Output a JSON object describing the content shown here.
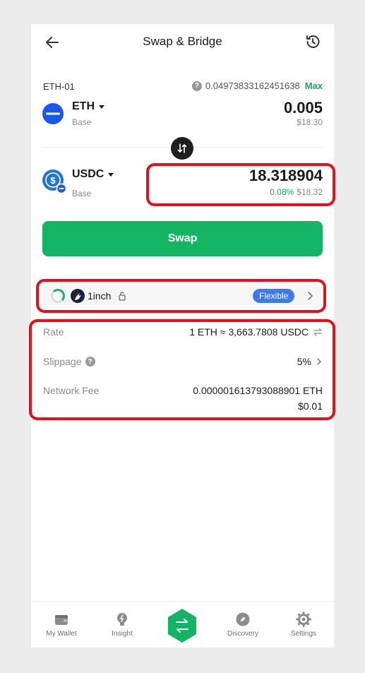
{
  "header": {
    "title": "Swap & Bridge",
    "back_icon": "arrow-left-icon",
    "history_icon": "history-icon"
  },
  "from": {
    "account": "ETH-01",
    "balance": "0.04973833162451638",
    "max_label": "Max",
    "symbol": "ETH",
    "network": "Base",
    "amount": "0.005",
    "usd": "$18.30"
  },
  "to": {
    "symbol": "USDC",
    "network": "Base",
    "amount": "18.318904",
    "pct": "0.08%",
    "usd": "$18.32"
  },
  "swap_button": "Swap",
  "route": {
    "provider": "1inch",
    "badge": "Flexible"
  },
  "info": {
    "rate_label": "Rate",
    "rate_value": "1 ETH ≈ 3,663.7808 USDC",
    "slippage_label": "Slippage",
    "slippage_value": "5%",
    "fee_label": "Network Fee",
    "fee_eth": "0.000001613793088901 ETH",
    "fee_usd": "$0.01"
  },
  "tabs": {
    "wallet": "My Wallet",
    "insight": "Insight",
    "discovery": "Discovery",
    "settings": "Settings"
  },
  "colors": {
    "accent_green": "#13b464",
    "badge_blue": "#3d7be6",
    "highlight_red": "#e4101a",
    "eth_blue": "#1a56f0",
    "usdc_blue": "#2775ca"
  }
}
